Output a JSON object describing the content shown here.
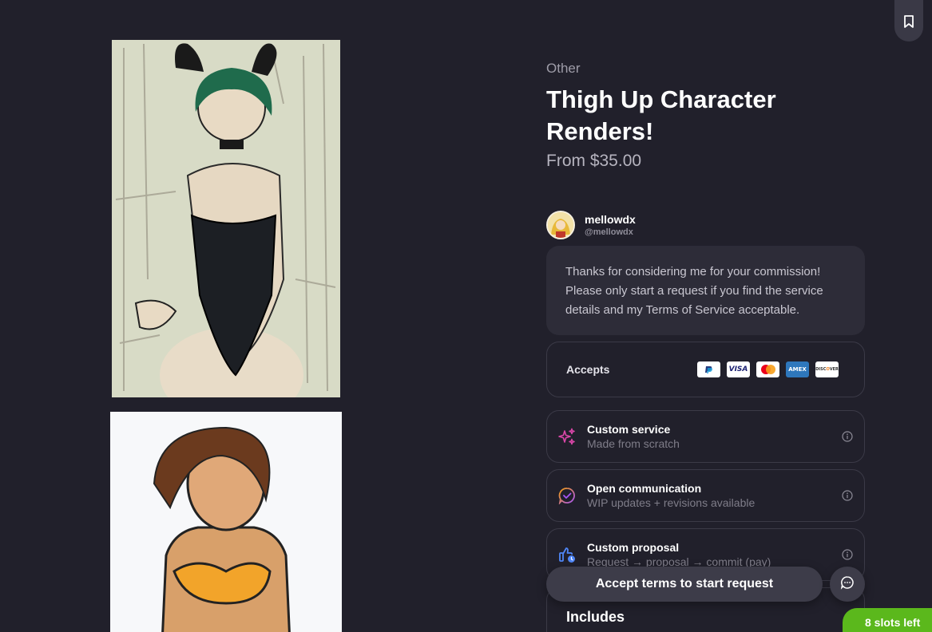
{
  "listing": {
    "category": "Other",
    "title": "Thigh Up Character Renders!",
    "price": "From $35.00"
  },
  "seller": {
    "name": "mellowdx",
    "handle": "@mellowdx"
  },
  "message": "Thanks for considering me for your commission! Please only start a request if you find the service details and my Terms of Service acceptable.",
  "accepts": {
    "label": "Accepts",
    "methods": [
      {
        "name": "PayPal",
        "icon": "paypal-icon"
      },
      {
        "name": "VISA",
        "icon": "visa-icon"
      },
      {
        "name": "Mastercard",
        "icon": "mastercard-icon"
      },
      {
        "name": "AMEX",
        "icon": "amex-icon"
      },
      {
        "name": "DISCOVER",
        "icon": "discover-icon"
      }
    ]
  },
  "features": [
    {
      "title": "Custom service",
      "subtitle": "Made from scratch",
      "icon": "sparkles-icon"
    },
    {
      "title": "Open communication",
      "subtitle": "WIP updates + revisions available",
      "icon": "chat-check-icon"
    },
    {
      "title": "Custom proposal",
      "subtitle": "Request → proposal → commit (pay)",
      "icon": "thumbs-up-clock-icon"
    }
  ],
  "includes": {
    "title": "Includes"
  },
  "cta": {
    "label": "Accept terms to start request"
  },
  "slots": {
    "label": "8 slots left"
  },
  "colors": {
    "background": "#21202b",
    "card_border": "#3b3a47",
    "slots_green": "#5bb81c",
    "sparkle_pink": "#d946a8",
    "chat_purple": "#a855f7"
  }
}
